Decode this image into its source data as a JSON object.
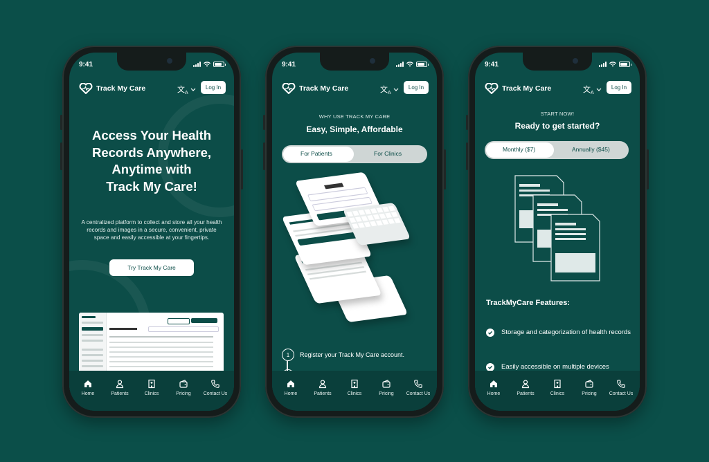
{
  "status": {
    "time": "9:41"
  },
  "header": {
    "brand": "Track My Care",
    "lang_icon": "translate-icon",
    "login_label": "Log In"
  },
  "nav": [
    {
      "label": "Home",
      "icon": "home-icon"
    },
    {
      "label": "Patients",
      "icon": "person-icon"
    },
    {
      "label": "Clinics",
      "icon": "building-icon"
    },
    {
      "label": "Pricing",
      "icon": "wallet-icon"
    },
    {
      "label": "Contact Us",
      "icon": "phone-icon"
    }
  ],
  "screen1": {
    "hero_lines": [
      "Access Your Health",
      "Records Anywhere,",
      "Anytime with",
      "Track My Care!"
    ],
    "description": "A centralized platform to collect and store all your health records and images in a secure, convenient, private space and easily accessible at your fingertips.",
    "cta_label": "Try Track My Care"
  },
  "screen2": {
    "kicker": "WHY USE TRACK MY CARE",
    "title": "Easy, Simple, Affordable",
    "tab_patients": "For Patients",
    "tab_clinics": "For Clinics",
    "step_number": "1",
    "step_text": "Register your Track My Care account."
  },
  "screen3": {
    "kicker": "START NOW!",
    "title": "Ready to get started?",
    "plan_monthly": "Monthly ($7)",
    "plan_annual": "Annually ($45)",
    "features_title": "TrackMyCare Features:",
    "features": [
      "Storage and categorization of health records",
      "Easily accessible on multiple devices"
    ]
  },
  "colors": {
    "background": "#0b4f49",
    "screen": "#0c4d48",
    "tabbar": "#0a3f3b",
    "accent": "#ffffff"
  }
}
